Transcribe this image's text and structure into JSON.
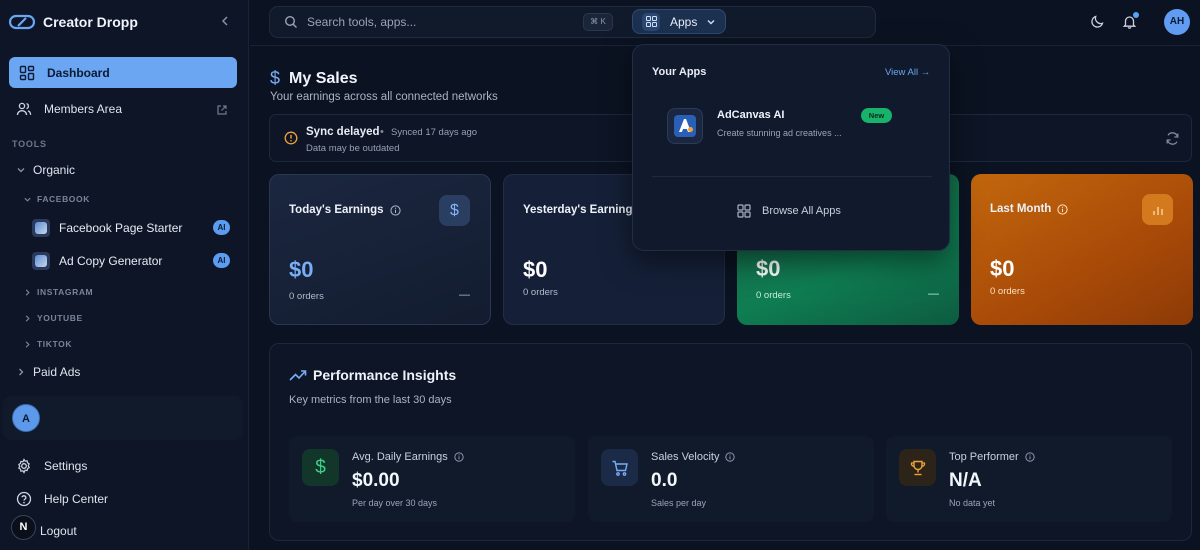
{
  "brand": {
    "name": "Creator Dropp"
  },
  "sidebar": {
    "dashboard_label": "Dashboard",
    "members_label": "Members Area",
    "tools_label": "TOOLS",
    "organic_label": "Organic",
    "facebook_label": "FACEBOOK",
    "tools": [
      {
        "label": "Facebook Page Starter",
        "badge": "AI"
      },
      {
        "label": "Ad Copy Generator",
        "badge": "AI"
      }
    ],
    "instagram_label": "INSTAGRAM",
    "youtube_label": "YOUTUBE",
    "tiktok_label": "TIKTOK",
    "paid_ads_label": "Paid Ads",
    "user_initial": "A",
    "settings_label": "Settings",
    "help_label": "Help Center",
    "logout_label": "Logout",
    "n_badge": "N"
  },
  "topbar": {
    "search_placeholder": "Search tools, apps...",
    "shortcut": "⌘ K",
    "apps_label": "Apps",
    "user_initials": "AH"
  },
  "main": {
    "title": "My Sales",
    "subtitle": "Your earnings across all connected networks",
    "sync": {
      "title": "Sync delayed",
      "separator": "•",
      "time": "Synced 17 days ago",
      "note": "Data may be outdated"
    },
    "cards": [
      {
        "title": "Today's Earnings",
        "value": "$0",
        "orders": "0 orders",
        "trend": "—"
      },
      {
        "title": "Yesterday's Earnings",
        "value": "$0",
        "orders": "0 orders"
      },
      {
        "value": "$0",
        "orders": "0 orders",
        "trend": "—"
      },
      {
        "title": "Last Month",
        "value": "$0",
        "orders": "0 orders"
      }
    ],
    "performance": {
      "title": "Performance Insights",
      "subtitle": "Key metrics from the last 30 days",
      "metrics": [
        {
          "label": "Avg. Daily Earnings",
          "value": "$0.00",
          "sub": "Per day over 30 days"
        },
        {
          "label": "Sales Velocity",
          "value": "0.0",
          "sub": "Sales per day"
        },
        {
          "label": "Top Performer",
          "value": "N/A",
          "sub": "No data yet"
        }
      ]
    }
  },
  "apps_dropdown": {
    "title": "Your Apps",
    "view_all": "View All →",
    "app": {
      "name": "AdCanvas AI",
      "badge": "New",
      "description": "Create stunning ad creatives ..."
    },
    "browse_label": "Browse All Apps"
  },
  "colors": {
    "accent": "#6aa6f2",
    "green_card": "#0f7d52",
    "orange_card": "#b5590a",
    "background": "#0b1322"
  }
}
